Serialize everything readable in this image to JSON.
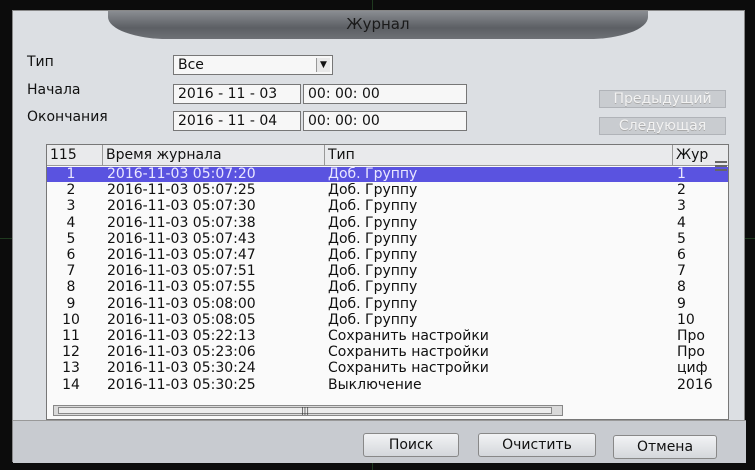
{
  "window": {
    "title": "Журнал"
  },
  "filters": {
    "type_label": "Тип",
    "type_value": "Все",
    "start_label": "Начала",
    "start_date": "2016 - 11 - 03",
    "start_time": "00: 00: 00",
    "end_label": "Окончания",
    "end_date": "2016 - 11 - 04",
    "end_time": "00: 00: 00",
    "prev_label": "Предыдущий",
    "next_label": "Следующая"
  },
  "table": {
    "count": "115",
    "columns": [
      "Время журнала",
      "Тип",
      "Жур"
    ],
    "rows": [
      {
        "n": "1",
        "time": "2016-11-03 05:07:20",
        "type": "Доб. Группу",
        "log": "1"
      },
      {
        "n": "2",
        "time": "2016-11-03 05:07:25",
        "type": "Доб. Группу",
        "log": "2"
      },
      {
        "n": "3",
        "time": "2016-11-03 05:07:30",
        "type": "Доб. Группу",
        "log": "3"
      },
      {
        "n": "4",
        "time": "2016-11-03 05:07:38",
        "type": "Доб. Группу",
        "log": "4"
      },
      {
        "n": "5",
        "time": "2016-11-03 05:07:43",
        "type": "Доб. Группу",
        "log": "5"
      },
      {
        "n": "6",
        "time": "2016-11-03 05:07:47",
        "type": "Доб. Группу",
        "log": "6"
      },
      {
        "n": "7",
        "time": "2016-11-03 05:07:51",
        "type": "Доб. Группу",
        "log": "7"
      },
      {
        "n": "8",
        "time": "2016-11-03 05:07:55",
        "type": "Доб. Группу",
        "log": "8"
      },
      {
        "n": "9",
        "time": "2016-11-03 05:08:00",
        "type": "Доб. Группу",
        "log": "9"
      },
      {
        "n": "10",
        "time": "2016-11-03 05:08:05",
        "type": "Доб. Группу",
        "log": "10"
      },
      {
        "n": "11",
        "time": "2016-11-03 05:22:13",
        "type": "Сохранить настройки",
        "log": "Про"
      },
      {
        "n": "12",
        "time": "2016-11-03 05:23:06",
        "type": "Сохранить настройки",
        "log": "Про"
      },
      {
        "n": "13",
        "time": "2016-11-03 05:30:24",
        "type": "Сохранить настройки",
        "log": "циф"
      },
      {
        "n": "14",
        "time": "2016-11-03 05:30:25",
        "type": "Выключение",
        "log": "2016"
      }
    ]
  },
  "actions": {
    "search": "Поиск",
    "clear": "Очистить",
    "cancel": "Отмена"
  },
  "colors": {
    "selected_row": "#5a53e0",
    "window_bg": "#dcdfe3"
  }
}
